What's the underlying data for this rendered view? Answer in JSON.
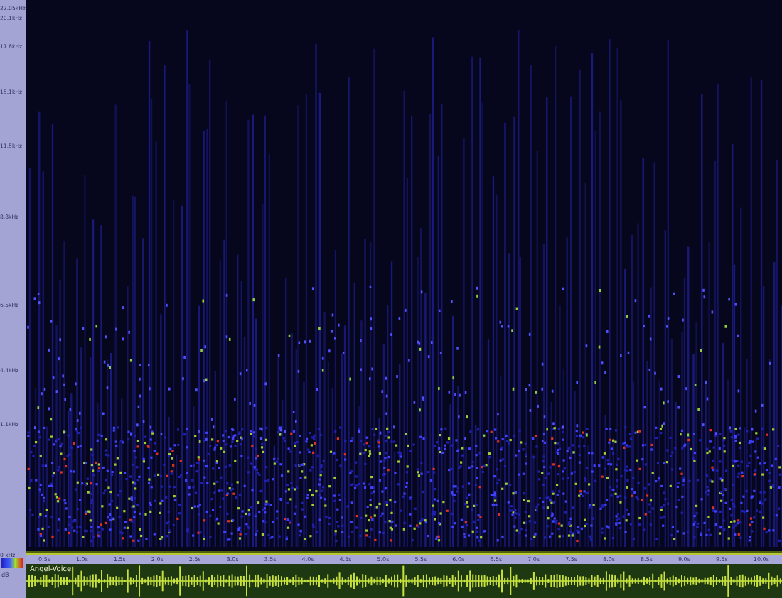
{
  "frequency_axis": {
    "labels": [
      "22.05kHz",
      "20.1kHz",
      "17.6kHz",
      "15.1kHz",
      "11.5kHz",
      "8.8kHz",
      "6.5kHz",
      "4.4kHz",
      "1.1kHz",
      "0 kHz"
    ]
  },
  "time_axis": {
    "ticks": [
      "0.5s",
      "1.0s",
      "1.5s",
      "2.0s",
      "2.5s",
      "3.0s",
      "3.5s",
      "4.0s",
      "4.5s",
      "5.0s",
      "5.5s",
      "6.0s",
      "6.5s",
      "7.0s",
      "7.5s",
      "8.0s",
      "8.5s",
      "9.0s",
      "9.5s",
      "10.0s"
    ]
  },
  "color_scale": {
    "label": "dB"
  },
  "waveform": {
    "title": "Angel-Voice"
  }
}
